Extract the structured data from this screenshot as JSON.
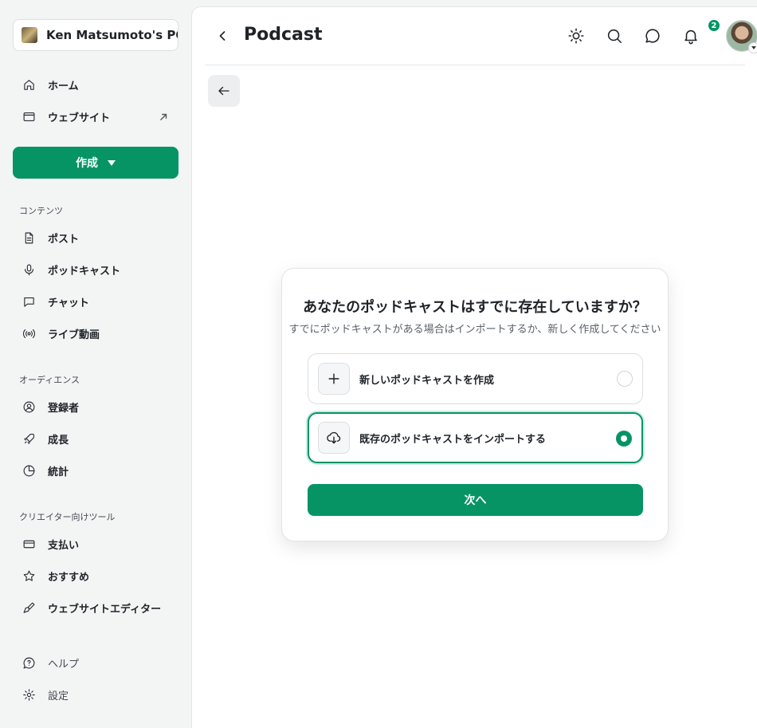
{
  "sidebar": {
    "publication": "Ken Matsumoto's PO...",
    "home": "ホーム",
    "website": "ウェブサイト",
    "create": "作成",
    "sections": {
      "content": "コンテンツ",
      "audience": "オーディエンス",
      "creator_tools": "クリエイター向けツール"
    },
    "content_items": [
      "ポスト",
      "ポッドキャスト",
      "チャット",
      "ライブ動画"
    ],
    "audience_items": [
      "登録者",
      "成長",
      "統計"
    ],
    "tool_items": [
      "支払い",
      "おすすめ",
      "ウェブサイトエディター"
    ],
    "help": "ヘルプ",
    "settings": "設定"
  },
  "header": {
    "title": "Podcast",
    "notification_count": "2"
  },
  "dialog": {
    "title": "あなたのポッドキャストはすでに存在していますか？",
    "subtitle": "すでにポッドキャストがある場合はインポートするか、新しく作成してください",
    "options": [
      {
        "label": "新しいポッドキャストを作成",
        "icon": "plus-icon",
        "selected": false
      },
      {
        "label": "既存のポッドキャストをインポートする",
        "icon": "cloud-download-icon",
        "selected": true
      }
    ],
    "next": "次へ"
  },
  "colors": {
    "accent": "#069465",
    "sidebar_bg": "#f3f4f4"
  }
}
